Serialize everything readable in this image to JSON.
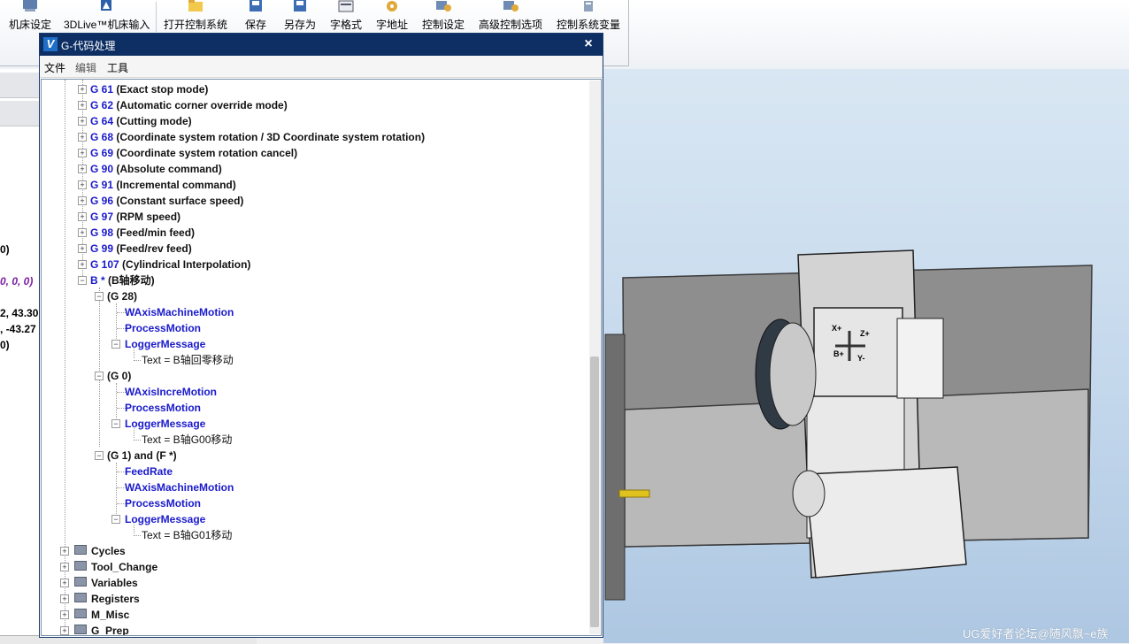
{
  "ribbon": {
    "buttons": [
      "机床设定",
      "3DLive™机床输入",
      "打开控制系统",
      "保存",
      "另存为",
      "字格式",
      "字地址",
      "控制设定",
      "高级控制选项",
      "控制系统变量"
    ]
  },
  "left_panel": {
    "lines": [
      "0)",
      "0, 0, 0)",
      "2, 43.30",
      ", -43.27",
      "0)"
    ]
  },
  "dialog": {
    "title": "G-代码处理",
    "menu": [
      "文件",
      "编辑",
      "工具"
    ]
  },
  "tree": {
    "gcodes": [
      {
        "code": "G 61",
        "desc": "(Exact stop mode)"
      },
      {
        "code": "G 62",
        "desc": "(Automatic corner override mode)"
      },
      {
        "code": "G 64",
        "desc": "(Cutting mode)"
      },
      {
        "code": "G 68",
        "desc": "(Coordinate system rotation / 3D Coordinate system rotation)"
      },
      {
        "code": "G 69",
        "desc": "(Coordinate system rotation cancel)"
      },
      {
        "code": "G 90",
        "desc": "(Absolute command)"
      },
      {
        "code": "G 91",
        "desc": "(Incremental command)"
      },
      {
        "code": "G 96",
        "desc": "(Constant surface speed)"
      },
      {
        "code": "G 97",
        "desc": "(RPM speed)"
      },
      {
        "code": "G 98",
        "desc": "(Feed/min feed)"
      },
      {
        "code": "G 99",
        "desc": "(Feed/rev feed)"
      },
      {
        "code": "G 107",
        "desc": "(Cylindrical Interpolation)"
      }
    ],
    "b_node": {
      "code": "B *",
      "desc": "(B轴移动)"
    },
    "g28": {
      "label": "(G 28)",
      "items": [
        "WAxisMachineMotion",
        "ProcessMotion",
        "LoggerMessage"
      ],
      "text": "Text = B轴回零移动"
    },
    "g0": {
      "label": "(G 0)",
      "items": [
        "WAxisIncreMotion",
        "ProcessMotion",
        "LoggerMessage"
      ],
      "text": "Text = B轴G00移动"
    },
    "g1": {
      "label": "(G 1) and (F *)",
      "items": [
        "FeedRate",
        "WAxisMachineMotion",
        "ProcessMotion",
        "LoggerMessage"
      ],
      "text": "Text = B轴G01移动"
    },
    "groups": [
      "Cycles",
      "Tool_Change",
      "Variables",
      "Registers",
      "M_Misc",
      "G_Prep"
    ]
  },
  "machine_labels": {
    "x_plus": "X+",
    "z_plus": "Z+",
    "b_plus": "B+",
    "y_minus": "Y-"
  },
  "watermark": "UG爱好者论坛@随风飘~e族",
  "colors": {
    "titlebar": "#0d2f63",
    "tree_blue": "#1a1acc",
    "left_purple": "#7a1fa2"
  }
}
